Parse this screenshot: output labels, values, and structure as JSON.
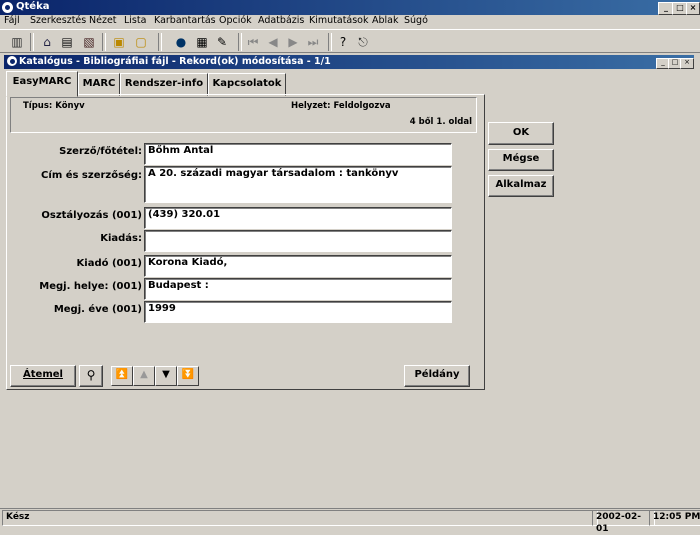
{
  "app": {
    "title": "Qtéka"
  },
  "menu": [
    "Fájl",
    "Szerkesztés",
    "Nézet",
    "Lista",
    "Karbantartás",
    "Opciók",
    "Adatbázis",
    "Kimutatások",
    "Ablak",
    "Súgó"
  ],
  "child": {
    "title": "Katalógus - Bibliográfiai fájl - Rekord(ok) módosítása - 1/1"
  },
  "tabs": [
    "EasyMARC",
    "MARC",
    "Rendszer-info",
    "Kapcsolatok"
  ],
  "info": {
    "tipus": "Típus: Könyv",
    "helyzet": "Helyzet: Feldolgozva",
    "page": "4 ből 1. oldal"
  },
  "fields": [
    {
      "label": "Szerző/főtétel:",
      "value": "Bőhm Antal"
    },
    {
      "label": "Cím és szerzőség:",
      "value": "A 20. századi magyar társadalom : tankönyv"
    },
    {
      "label": "Osztályozás (001)",
      "value": "(439) 320.01"
    },
    {
      "label": "Kiadás:",
      "value": ""
    },
    {
      "label": "Kiadó (001)",
      "value": "Korona Kiadó,"
    },
    {
      "label": "Megj. helye: (001)",
      "value": "Budapest :"
    },
    {
      "label": "Megj. éve (001)",
      "value": "1999"
    }
  ],
  "buttons": {
    "ok": "OK",
    "cancel": "Mégse",
    "apply": "Alkalmaz",
    "atemel": "Átemel",
    "peldany": "Példány"
  },
  "status": {
    "text": "Kész",
    "date": "2002-02-01",
    "time": "12:05 PM"
  }
}
